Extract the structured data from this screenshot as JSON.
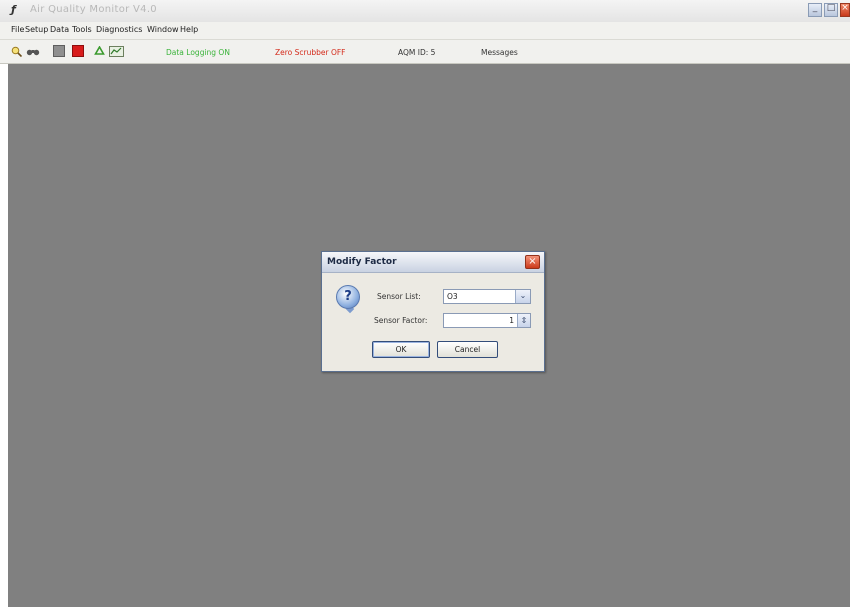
{
  "window": {
    "title": "Air Quality Monitor V4.0",
    "app_icon": "feather-icon",
    "controls": [
      "minimize",
      "maximize",
      "close"
    ]
  },
  "menu": [
    "File",
    "Setup",
    "Data",
    "Tools",
    "Diagnostics",
    "Window",
    "Help"
  ],
  "toolbar": {
    "icons": [
      "search-icon",
      "binoculars-icon",
      "grey-square-icon",
      "red-square-icon",
      "recycle-icon",
      "chart-icon"
    ],
    "status_logging": "Data Logging ON",
    "status_scrubber": "Zero Scrubber OFF",
    "status_aqm": "AQM ID: 5",
    "messages": "Messages",
    "colors": {
      "logging": "#3ab33a",
      "scrubber": "#d42a1a"
    }
  },
  "dialog": {
    "title": "Modify Factor",
    "icon": "question-icon",
    "sensor_list_label": "Sensor List:",
    "sensor_list_value": "O3",
    "sensor_factor_label": "Sensor Factor:",
    "sensor_factor_value": "1",
    "ok_label": "OK",
    "cancel_label": "Cancel"
  },
  "colors": {
    "workspace": "#808080"
  }
}
